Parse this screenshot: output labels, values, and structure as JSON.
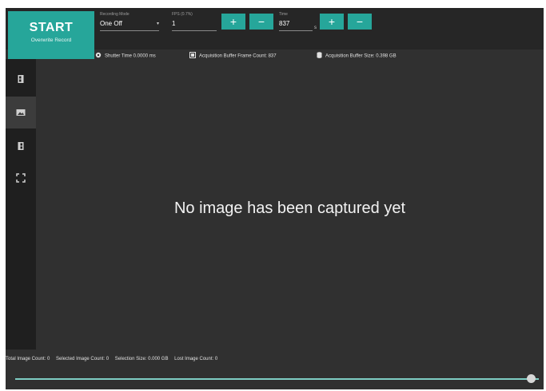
{
  "toolbar": {
    "start_label": "START",
    "start_sub": "Overwrite Record",
    "recording_mode": {
      "label": "Recording Mode",
      "value": "One Off"
    },
    "fps": {
      "label": "FPS (0.7%)",
      "value": "1"
    },
    "time": {
      "label": "Time",
      "value": "837",
      "unit": "s"
    },
    "plus_glyph": "+",
    "minus_glyph": "−"
  },
  "infobar": {
    "shutter": "Shutter Time 0.0000 ms",
    "frame_count": "Acquisition Buffer Frame Count: 837",
    "buffer_size": "Acquisition Buffer Size: 0.398 GB"
  },
  "sidebar": {
    "items": [
      {
        "icon": "film-strip-icon"
      },
      {
        "icon": "image-icon",
        "active": true
      },
      {
        "icon": "film-strip-icon"
      },
      {
        "icon": "fullscreen-icon"
      }
    ]
  },
  "main": {
    "message": "No image has been captured yet"
  },
  "footer": {
    "total": "Total Image Count: 0",
    "selected": "Selected Image Count: 0",
    "size": "Selection Size: 0.000 GB",
    "lost": "Lost Image Count: 0"
  },
  "slider": {
    "position": 0.985
  },
  "colors": {
    "accent": "#26a69a",
    "background": "#303030",
    "toolbar": "#262626",
    "sidebar": "#1f1f1f"
  }
}
